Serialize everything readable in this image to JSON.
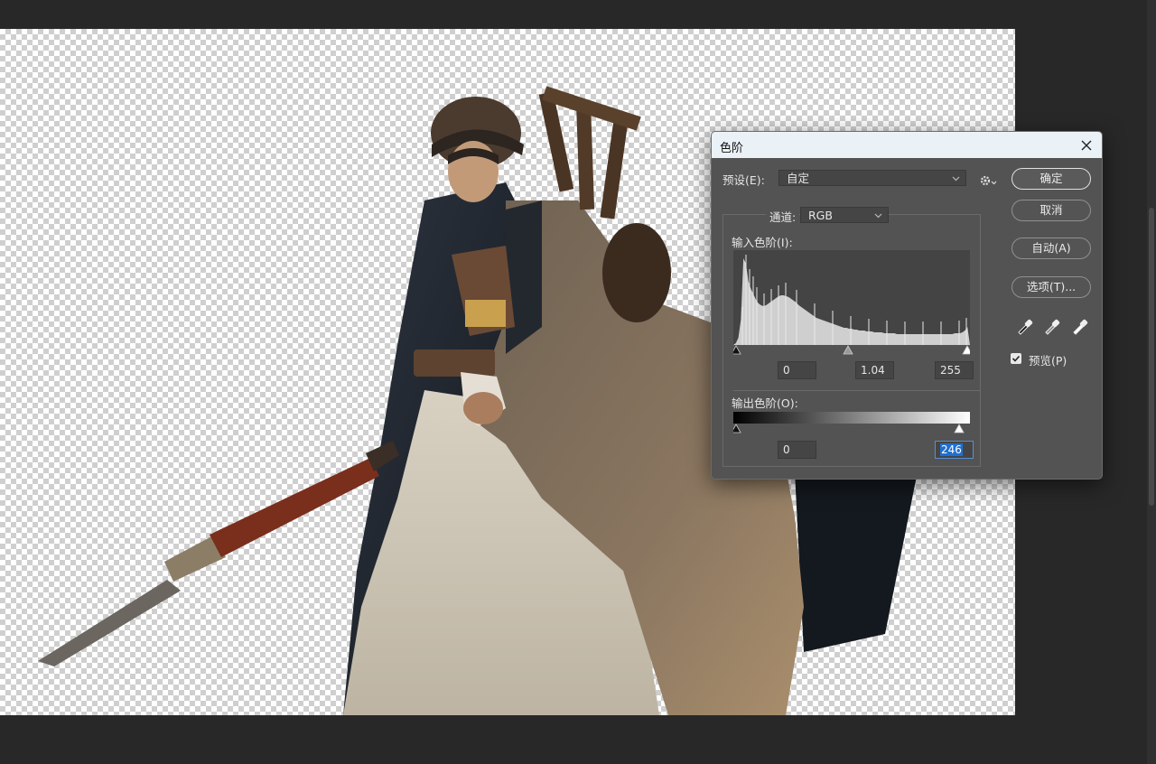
{
  "dialog": {
    "title": "色阶",
    "preset_label": "预设(E):",
    "preset_value": "自定",
    "channel_label": "通道:",
    "channel_value": "RGB",
    "input_levels_label": "输入色阶(I):",
    "input_black": "0",
    "input_gamma": "1.04",
    "input_white": "255",
    "output_levels_label": "输出色阶(O):",
    "output_black": "0",
    "output_white": "246",
    "buttons": {
      "ok": "确定",
      "cancel": "取消",
      "auto": "自动(A)",
      "options": "选项(T)..."
    },
    "preview_label": "预览(P)",
    "preview_checked": true
  },
  "icons": {
    "close": "close-icon",
    "gear": "gear-icon",
    "eyedroppers": [
      "black-eyedropper-icon",
      "gray-eyedropper-icon",
      "white-eyedropper-icon"
    ]
  },
  "histogram_profile": [
    0,
    2,
    8,
    28,
    96,
    90,
    70,
    62,
    56,
    50,
    46,
    44,
    43,
    44,
    46,
    48,
    50,
    52,
    54,
    55,
    55,
    54,
    53,
    51,
    49,
    47,
    44,
    42,
    40,
    38,
    36,
    34,
    32,
    30,
    29,
    28,
    27,
    26,
    25,
    24,
    23,
    22,
    21,
    20,
    19,
    19,
    18,
    18,
    17,
    17,
    16,
    16,
    16,
    15,
    15,
    15,
    14,
    14,
    14,
    14,
    13,
    13,
    13,
    13,
    13,
    12,
    12,
    12,
    12,
    12,
    12,
    12,
    12,
    12,
    12,
    12,
    12,
    12,
    12,
    12,
    12,
    12,
    12,
    12,
    12,
    12,
    12,
    12,
    13,
    13,
    13,
    14,
    16,
    20
  ]
}
